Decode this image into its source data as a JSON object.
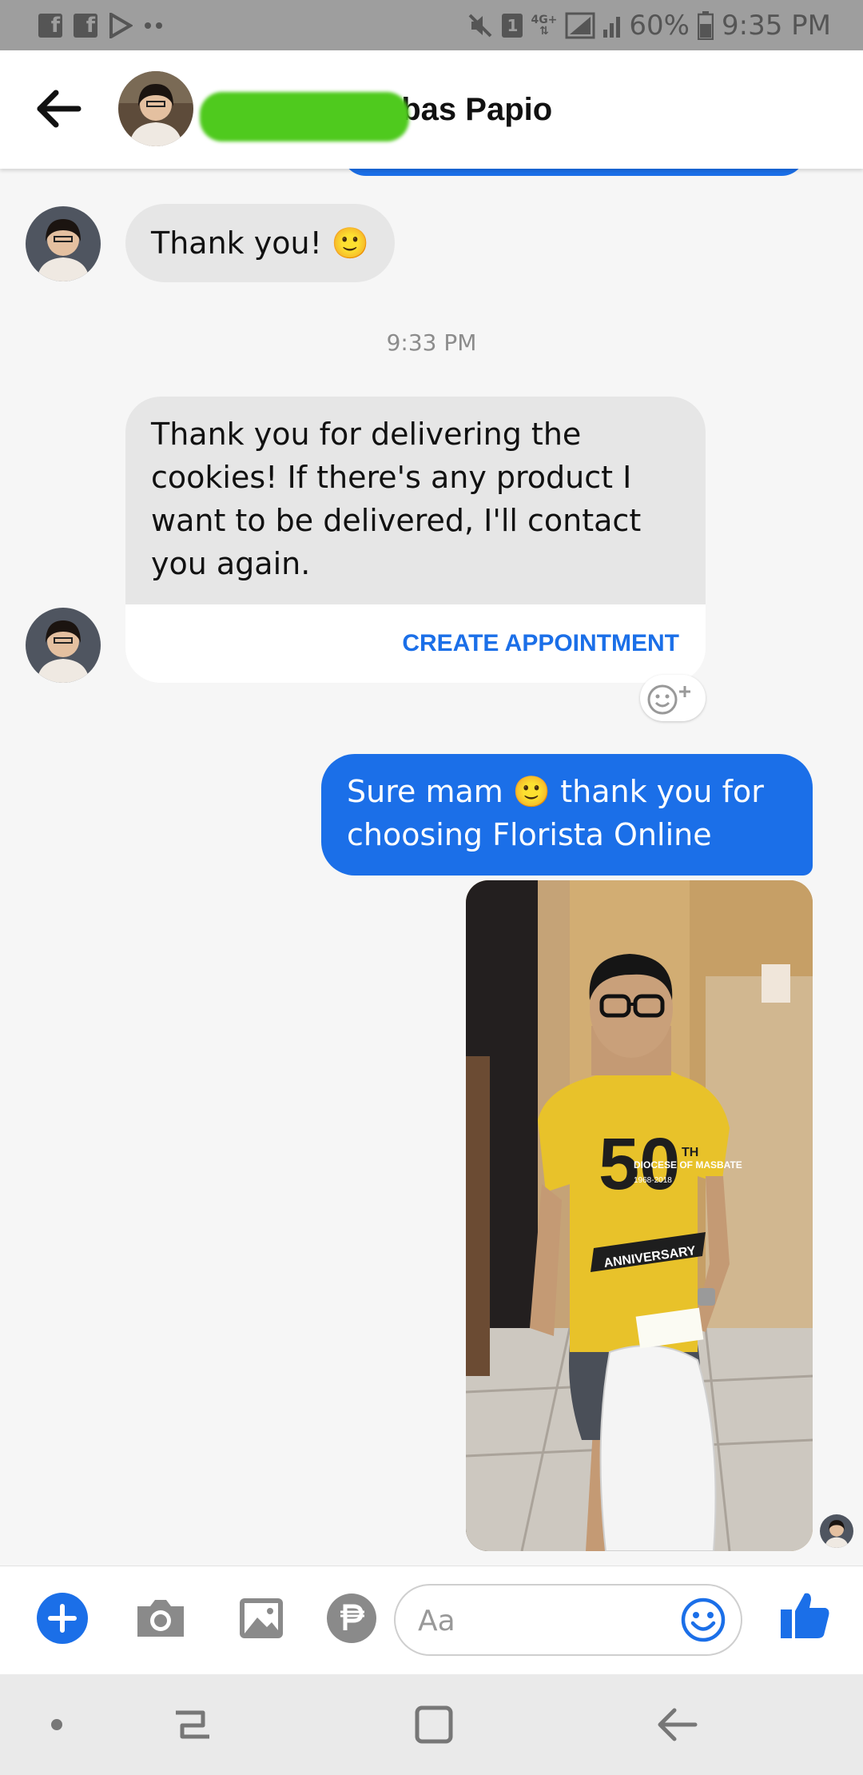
{
  "status_bar": {
    "time": "9:35 PM",
    "battery": "60%",
    "network": "4G+",
    "sim_badge": "1",
    "app_icons": [
      "facebook-icon",
      "facebook-icon",
      "play-store-icon"
    ]
  },
  "header": {
    "contact_name_visible": "abas Papio"
  },
  "messages": [
    {
      "side": "in",
      "text": "Thank you! 🙂"
    },
    {
      "type": "timestamp",
      "text": "9:33 PM"
    },
    {
      "side": "in",
      "text": "Thank you for delivering the cookies! If there's any product I want to be delivered, I'll contact you again.",
      "action": "CREATE APPOINTMENT"
    },
    {
      "side": "out",
      "text": "Sure mam 🙂 thank you for choosing Florista Online"
    },
    {
      "side": "out",
      "type": "photo",
      "shirt_text": {
        "top": "DIOCESE OF MASBATE",
        "years": "1968-2018",
        "number": "50",
        "suffix": "TH",
        "banner": "ANNIVERSARY"
      }
    }
  ],
  "composer": {
    "placeholder": "Aa"
  },
  "colors": {
    "accent": "#1b6fe8",
    "incoming_bubble": "#e6e6e6",
    "status_bar": "#9e9e9e",
    "redaction": "#4fca1e"
  },
  "icons": {
    "composer": [
      "plus-icon",
      "camera-icon",
      "gallery-icon",
      "peso-icon",
      "emoji-icon",
      "like-icon"
    ],
    "nav": [
      "dot-icon",
      "recents-icon",
      "home-icon",
      "back-icon"
    ]
  }
}
